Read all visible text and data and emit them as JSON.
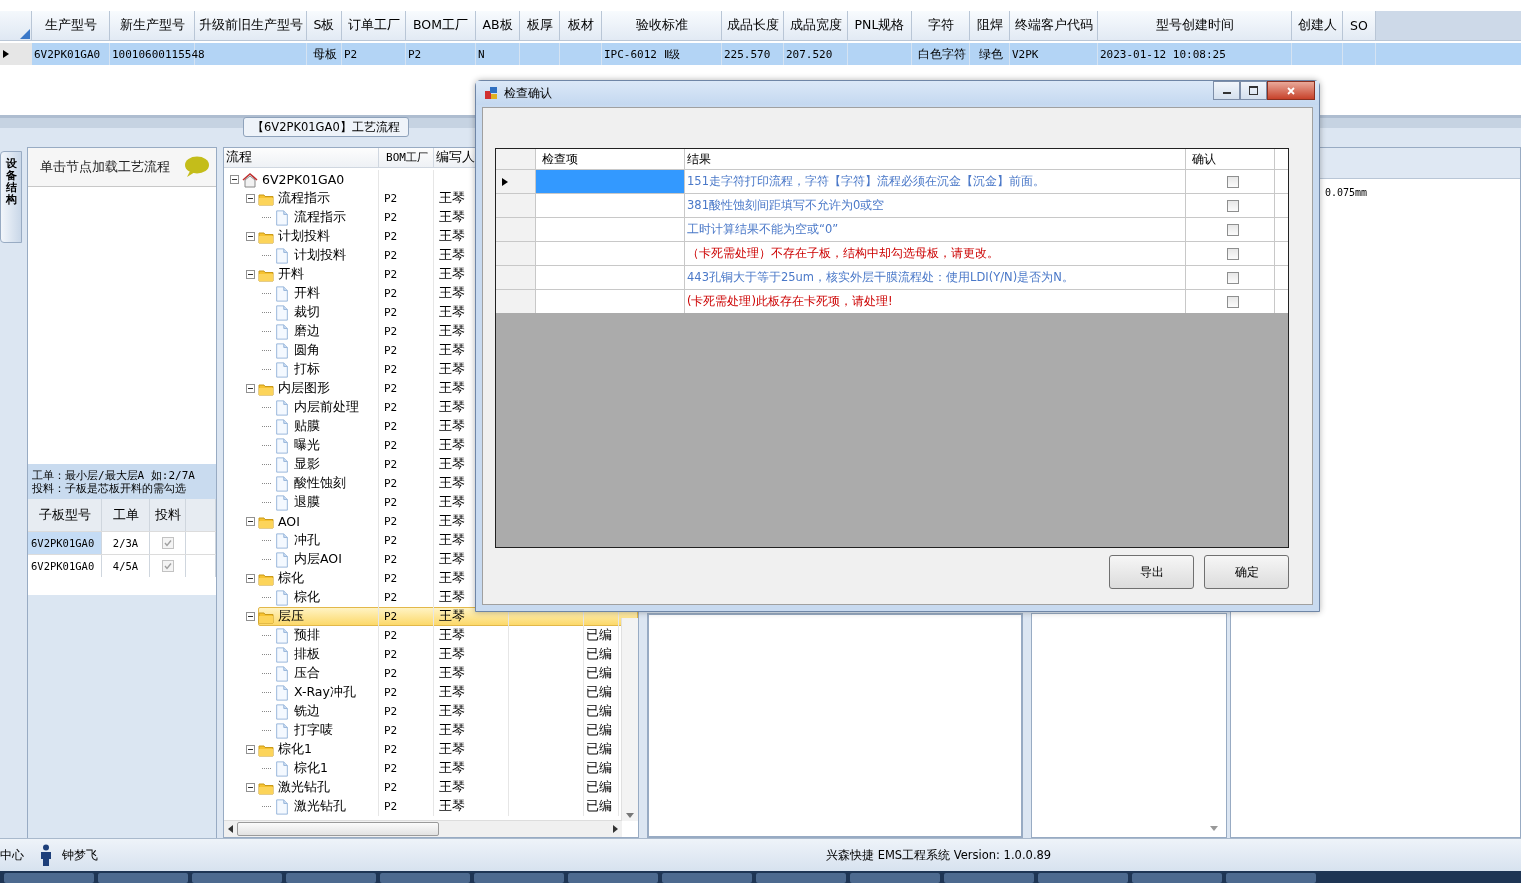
{
  "data_grid": {
    "columns": [
      "生产型号",
      "新生产型号",
      "升级前旧生产型号",
      "S板",
      "订单工厂",
      "BOM工厂",
      "AB板",
      "板厚",
      "板材",
      "验收标准",
      "成品长度",
      "成品宽度",
      "PNL规格",
      "字符",
      "阻焊",
      "终端客户代码",
      "型号创建时间",
      "创建人",
      "SO"
    ],
    "rows": [
      {
        "selected": true,
        "cells": [
          "6V2PK01GA0",
          "10010600115548",
          null,
          "母板",
          "P2",
          "P2",
          "N",
          null,
          null,
          "IPC-6012 Ⅱ级",
          "225.570",
          "207.520",
          null,
          "白色字符",
          "绿色",
          "V2PK",
          "2023-01-12 10:08:25",
          null,
          null
        ]
      }
    ]
  },
  "process_tab": {
    "title": "【6V2PK01GA0】工艺流程"
  },
  "side_tab": {
    "label": "设备结构"
  },
  "node_panel": {
    "hint": "单击节点加载工艺流程",
    "notes": [
      "工单：最小层/最大层A 如:2/7A",
      "投料：子板是芯板开料的需勾选"
    ],
    "grid": {
      "columns": [
        "子板型号",
        "工单",
        "投料"
      ],
      "rows": [
        {
          "board": "6V2PK01GA0",
          "order": "2/3A",
          "feed": true,
          "selected": true
        },
        {
          "board": "6V2PK01GA0",
          "order": "4/5A",
          "feed": true,
          "selected": false
        }
      ]
    }
  },
  "process_tree": {
    "columns": [
      "流程",
      "BOM工厂",
      "编写人"
    ],
    "nodes": [
      {
        "kind": "root",
        "label": "6V2PK01GA0",
        "expanded": true,
        "selected": false,
        "children": [
          {
            "kind": "folder",
            "label": "流程指示",
            "bom": "P2",
            "writer": "王琴",
            "expanded": true,
            "selected": false,
            "children": [
              {
                "kind": "step",
                "label": "流程指示",
                "bom": "P2",
                "writer": "王琴",
                "selected": false
              }
            ]
          },
          {
            "kind": "folder",
            "label": "计划投料",
            "bom": "P2",
            "writer": "王琴",
            "expanded": true,
            "selected": false,
            "children": [
              {
                "kind": "step",
                "label": "计划投料",
                "bom": "P2",
                "writer": "王琴",
                "selected": false
              }
            ]
          },
          {
            "kind": "folder",
            "label": "开料",
            "bom": "P2",
            "writer": "王琴",
            "expanded": true,
            "selected": false,
            "children": [
              {
                "kind": "step",
                "label": "开料",
                "bom": "P2",
                "writer": "王琴",
                "selected": false
              },
              {
                "kind": "step",
                "label": "裁切",
                "bom": "P2",
                "writer": "王琴",
                "selected": false
              },
              {
                "kind": "step",
                "label": "磨边",
                "bom": "P2",
                "writer": "王琴",
                "selected": false
              },
              {
                "kind": "step",
                "label": "圆角",
                "bom": "P2",
                "writer": "王琴",
                "selected": false
              },
              {
                "kind": "step",
                "label": "打标",
                "bom": "P2",
                "writer": "王琴",
                "selected": false
              }
            ]
          },
          {
            "kind": "folder",
            "label": "内层图形",
            "bom": "P2",
            "writer": "王琴",
            "expanded": true,
            "selected": false,
            "children": [
              {
                "kind": "step",
                "label": "内层前处理",
                "bom": "P2",
                "writer": "王琴",
                "selected": false
              },
              {
                "kind": "step",
                "label": "贴膜",
                "bom": "P2",
                "writer": "王琴",
                "selected": false
              },
              {
                "kind": "step",
                "label": "曝光",
                "bom": "P2",
                "writer": "王琴",
                "selected": false
              },
              {
                "kind": "step",
                "label": "显影",
                "bom": "P2",
                "writer": "王琴",
                "selected": false
              },
              {
                "kind": "step",
                "label": "酸性蚀刻",
                "bom": "P2",
                "writer": "王琴",
                "selected": false
              },
              {
                "kind": "step",
                "label": "退膜",
                "bom": "P2",
                "writer": "王琴",
                "selected": false
              }
            ]
          },
          {
            "kind": "folder",
            "label": "AOI",
            "bom": "P2",
            "writer": "王琴",
            "expanded": true,
            "selected": false,
            "children": [
              {
                "kind": "step",
                "label": "冲孔",
                "bom": "P2",
                "writer": "王琴",
                "selected": false
              },
              {
                "kind": "step",
                "label": "内层AOI",
                "bom": "P2",
                "writer": "王琴",
                "selected": false
              }
            ]
          },
          {
            "kind": "folder",
            "label": "棕化",
            "bom": "P2",
            "writer": "王琴",
            "expanded": true,
            "selected": false,
            "children": [
              {
                "kind": "step",
                "label": "棕化",
                "bom": "P2",
                "writer": "王琴",
                "selected": false
              }
            ]
          },
          {
            "kind": "folder",
            "label": "层压",
            "bom": "P2",
            "writer": "王琴",
            "expanded": true,
            "selected": true,
            "children": [
              {
                "kind": "step",
                "label": "预排",
                "bom": "P2",
                "writer": "王琴",
                "status": "已编",
                "selected": false
              },
              {
                "kind": "step",
                "label": "排板",
                "bom": "P2",
                "writer": "王琴",
                "status": "已编",
                "selected": false
              },
              {
                "kind": "step",
                "label": "压合",
                "bom": "P2",
                "writer": "王琴",
                "status": "已编",
                "selected": false
              },
              {
                "kind": "step",
                "label": "X-Ray冲孔",
                "bom": "P2",
                "writer": "王琴",
                "status": "已编",
                "selected": false
              },
              {
                "kind": "step",
                "label": "铣边",
                "bom": "P2",
                "writer": "王琴",
                "status": "已编",
                "selected": false
              },
              {
                "kind": "step",
                "label": "打字唛",
                "bom": "P2",
                "writer": "王琴",
                "status": "已编",
                "selected": false
              }
            ]
          },
          {
            "kind": "folder",
            "label": "棕化1",
            "bom": "P2",
            "writer": "王琴",
            "status": "已编",
            "expanded": true,
            "selected": false,
            "children": [
              {
                "kind": "step",
                "label": "棕化1",
                "bom": "P2",
                "writer": "王琴",
                "status": "已编",
                "selected": false
              }
            ]
          },
          {
            "kind": "folder",
            "label": "激光钻孔",
            "bom": "P2",
            "writer": "王琴",
            "status": "已编",
            "expanded": true,
            "selected": false,
            "children": [
              {
                "kind": "step",
                "label": "激光钻孔",
                "bom": "P2",
                "writer": "王琴",
                "status": "已编",
                "selected": false
              }
            ]
          }
        ]
      }
    ]
  },
  "detail_panel": {
    "value": "0.075mm"
  },
  "dialog": {
    "title": "检查确认",
    "columns": [
      "检查项",
      "结果",
      "确认"
    ],
    "rows": [
      {
        "selected": true,
        "result": "151走字符打印流程，字符【字符】流程必须在沉金【沉金】前面。",
        "color": "#4a78c8",
        "confirmed": false
      },
      {
        "selected": false,
        "result": "381酸性蚀刻间距填写不允许为0或空",
        "color": "#4a78c8",
        "confirmed": false
      },
      {
        "selected": false,
        "result": "工时计算结果不能为空或“0”",
        "color": "#4a78c8",
        "confirmed": false
      },
      {
        "selected": false,
        "result": "（卡死需处理）不存在子板，结构中却勾选母板，请更改。",
        "color": "#cc0000",
        "confirmed": false
      },
      {
        "selected": false,
        "result": "443孔铜大于等于25um，核实外层干膜流程处：使用LDI(Y/N)是否为N。",
        "color": "#4a78c8",
        "confirmed": false
      },
      {
        "selected": false,
        "result": "(卡死需处理)此板存在卡死项，请处理!",
        "color": "#cc0000",
        "confirmed": false
      }
    ],
    "buttons": [
      "导出",
      "确定"
    ]
  },
  "status_bar": {
    "location": "中心",
    "user": "钟梦飞",
    "app": "兴森快捷 EMS工程系统 Version: 1.0.0.89"
  }
}
